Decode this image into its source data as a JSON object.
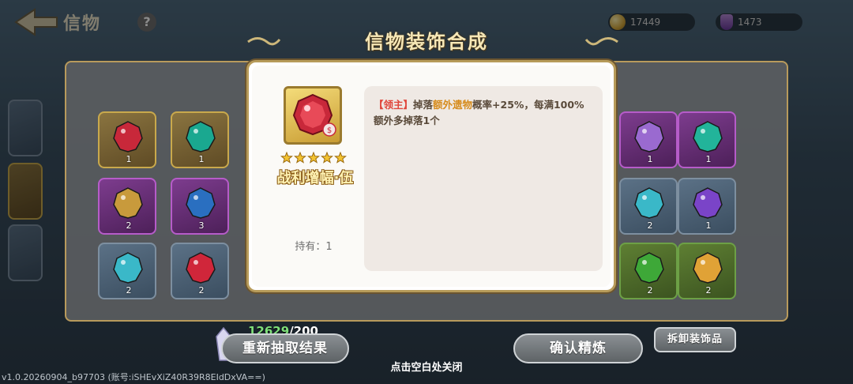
{
  "header": {
    "back_title": "信物",
    "help_symbol": "?",
    "currency_gold": "17449",
    "currency_potion": "1473"
  },
  "title": "信物装饰合成",
  "grid": {
    "cells": [
      {
        "count": "1",
        "style": "gold",
        "gem": "#c8283a"
      },
      {
        "count": "1",
        "style": "gold",
        "gem": "#1aa890"
      },
      {
        "count": "1",
        "style": "purple",
        "gem": "#9a6ad0"
      },
      {
        "count": "1",
        "style": "purple",
        "gem": "#22b49a"
      },
      {
        "count": "2",
        "style": "purple",
        "gem": "#c89a3c"
      },
      {
        "count": "3",
        "style": "purple",
        "gem": "#2a6fc0"
      },
      {
        "count": "2",
        "style": "blue",
        "gem": "#3ab8c8"
      },
      {
        "count": "1",
        "style": "blue",
        "gem": "#7a44c8"
      },
      {
        "count": "2",
        "style": "blue",
        "gem": "#3ab8c8"
      },
      {
        "count": "2",
        "style": "blue",
        "gem": "#d0263a"
      },
      {
        "count": "2",
        "style": "green",
        "gem": "#3ea838"
      },
      {
        "count": "2",
        "style": "green",
        "gem": "#e0a236"
      }
    ]
  },
  "popup": {
    "item_name": "战利增幅·伍",
    "stars": 5,
    "owned_label": "持有：1",
    "desc_tag": "【领主】",
    "desc_part1": "掉落",
    "desc_highlight": "额外遗物",
    "desc_part2": "概率+25%，每满100%额外多掉落1个"
  },
  "bottom": {
    "cost_have": "12629",
    "cost_need": "/200",
    "reroll_label": "重新抽取结果",
    "confirm_label": "确认精炼",
    "remove_label": "拆卸装饰品",
    "close_hint": "点击空白处关闭",
    "version": "v1.0.20260904_b97703 (账号:iSHEvXiZ40R39R8EIdDxVA==)"
  },
  "colors": {
    "accent_gold": "#b89a5c",
    "tag_red": "#e0473c",
    "highlight_orange": "#d68b1c"
  }
}
